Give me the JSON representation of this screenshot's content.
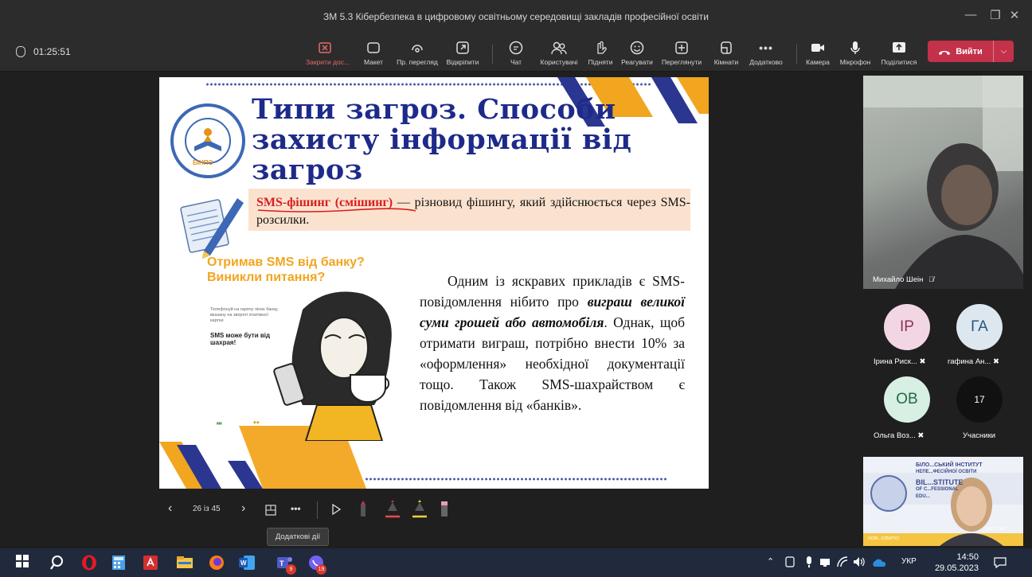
{
  "window": {
    "title": "ЗМ 5.3 Кібербезпека в цифровому освітньому середовищі закладів професійної освіти",
    "controls": [
      "—",
      "❐",
      "✕"
    ]
  },
  "meeting": {
    "elapsed": "01:25:51",
    "toolbar": [
      {
        "id": "stop-share",
        "label": "Закрити дос...",
        "icon": "stop-share-icon"
      },
      {
        "id": "layout",
        "label": "Макет",
        "icon": "layout-icon"
      },
      {
        "id": "view",
        "label": "Пр. перегляд",
        "icon": "view-icon"
      },
      {
        "id": "popout",
        "label": "Відкріпити",
        "icon": "popout-icon"
      },
      {
        "id": "chat",
        "label": "Чат",
        "icon": "chat-icon"
      },
      {
        "id": "people",
        "label": "Користувачі",
        "icon": "people-icon"
      },
      {
        "id": "raise",
        "label": "Підняти",
        "icon": "hand-icon"
      },
      {
        "id": "react",
        "label": "Реагувати",
        "icon": "smile-icon"
      },
      {
        "id": "apps",
        "label": "Переглянути",
        "icon": "grid-icon"
      },
      {
        "id": "rooms",
        "label": "Кімнати",
        "icon": "rooms-icon"
      },
      {
        "id": "more",
        "label": "Додатково",
        "icon": "more-icon"
      },
      {
        "id": "camera",
        "label": "Камера",
        "icon": "camera-icon"
      },
      {
        "id": "mic",
        "label": "Мікрофон",
        "icon": "mic-icon"
      },
      {
        "id": "share",
        "label": "Поділитися",
        "icon": "share-icon"
      }
    ],
    "leave_label": "Вийти"
  },
  "slide": {
    "title": "Типи загроз. Способи захисту інформації від загроз",
    "logo_text": "БІНПО",
    "definition_term": "SMS-фішинг (смішинг)",
    "definition_rest": " — різновид фішингу, який здійснюється через SMS-розсилки.",
    "promo_title": "Отримав SMS від банку? Виникли питання?",
    "promo_small": "Телефонуй на гарячу лінію банку, вказану на звороті платіжної картки",
    "promo_bold": "SMS може бути від шахрая!",
    "body_1": "Одним із яскравих прикладів є SMS-повідомлення нібито про ",
    "body_em": "виграш великої суми грошей або автомобіля",
    "body_2": ". Однак, щоб отримати виграш, потрібно внести 10% за «оформлення» необхідної документації тощо. Також SMS-шахрайством є повідомлення від «банків»."
  },
  "presenter_controls": {
    "page": "26 із 45",
    "tooltip": "Додаткові дії"
  },
  "participants": {
    "video_name": "Михайло Шеін",
    "list": [
      {
        "initials": "ІР",
        "name": "Ірина Риск...",
        "bg": "#f3d6e4",
        "fg": "#8a3257"
      },
      {
        "initials": "ГА",
        "name": "гафина Ан...",
        "bg": "#dce7f0",
        "fg": "#2b5580"
      },
      {
        "initials": "ОВ",
        "name": "Ольга Воз...",
        "bg": "#d8efe3",
        "fg": "#236a46"
      },
      {
        "initials": "17",
        "name": "Учасники",
        "bg": "#111111",
        "fg": "#ffffff"
      }
    ],
    "selfview_lines": [
      "БІЛО...СЬКИЙ ІНСТИТУТ",
      "НЕПЕ...ФЕСІЙНОЇ ОСВІТИ",
      "BIL...STITUTE",
      "OF C...FESSIONAL",
      "EDU...",
      "...ДАК СТАРТ",
      "НОВІ...ОЗВИТКУ"
    ]
  },
  "taskbar": {
    "lang": "УКР",
    "time": "14:50",
    "date": "29.05.2023",
    "badges": {
      "teams": "9",
      "other": "19"
    }
  },
  "colors": {
    "accent_red": "#c4314b",
    "slide_title": "#1e2a8a",
    "orange": "#f2a51f",
    "navy": "#2b3690"
  }
}
